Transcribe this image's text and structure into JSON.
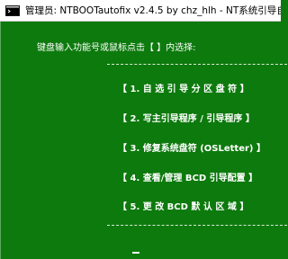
{
  "window": {
    "title": "管理员:  NTBOOTautofix v2.4.5 by chz_hlh - NT系统引导自"
  },
  "console": {
    "prompt": "键盘输入功能号或鼠标点击【 】内选择:",
    "menu": [
      {
        "label": "【 1. 自 选 引 导 分 区 盘 符 】"
      },
      {
        "label": "【 2. 写主引导程序 / 引导程序 】"
      },
      {
        "label": "【 3. 修复系统盘符 (OSLetter) 】"
      },
      {
        "label": "【 4. 查看/管理 BCD 引导配置  】"
      },
      {
        "label": "【 5. 更 改 BCD 默 认 区 域   】"
      }
    ]
  },
  "colors": {
    "console_bg": "#0d7a0d",
    "text": "#ffffff",
    "titlebar_bg": "#ffffff"
  }
}
